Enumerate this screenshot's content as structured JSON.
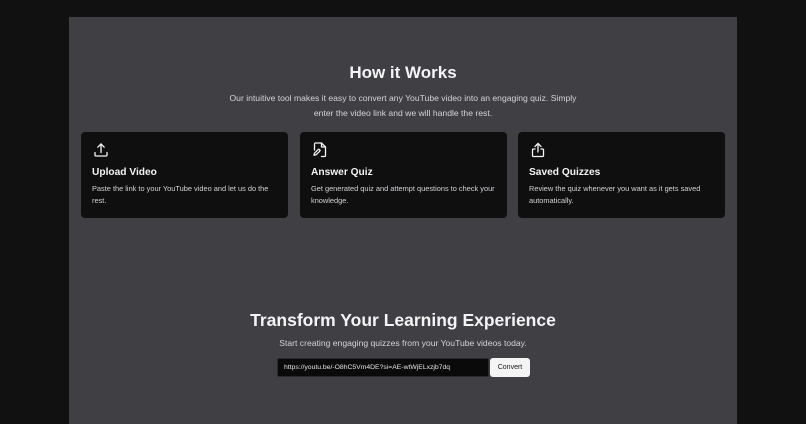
{
  "how_it_works": {
    "title": "How it Works",
    "subtitle": "Our intuitive tool makes it easy to convert any YouTube video into an engaging quiz. Simply enter the video link and we will handle the rest.",
    "cards": [
      {
        "icon": "upload-icon",
        "title": "Upload Video",
        "description": "Paste the link to your YouTube video and let us do the rest."
      },
      {
        "icon": "file-pen-icon",
        "title": "Answer Quiz",
        "description": "Get generated quiz and attempt questions to check your knowledge."
      },
      {
        "icon": "share-icon",
        "title": "Saved Quizzes",
        "description": "Review the quiz whenever you want as it gets saved automatically."
      }
    ]
  },
  "transform": {
    "title": "Transform Your Learning Experience",
    "subtitle": "Start creating engaging quizzes from your YouTube videos today.",
    "url_value": "https://youtu.be/-O8hC5Vm4DE?si=AE-wtWjELxzjb7dq",
    "convert_label": "Convert"
  }
}
